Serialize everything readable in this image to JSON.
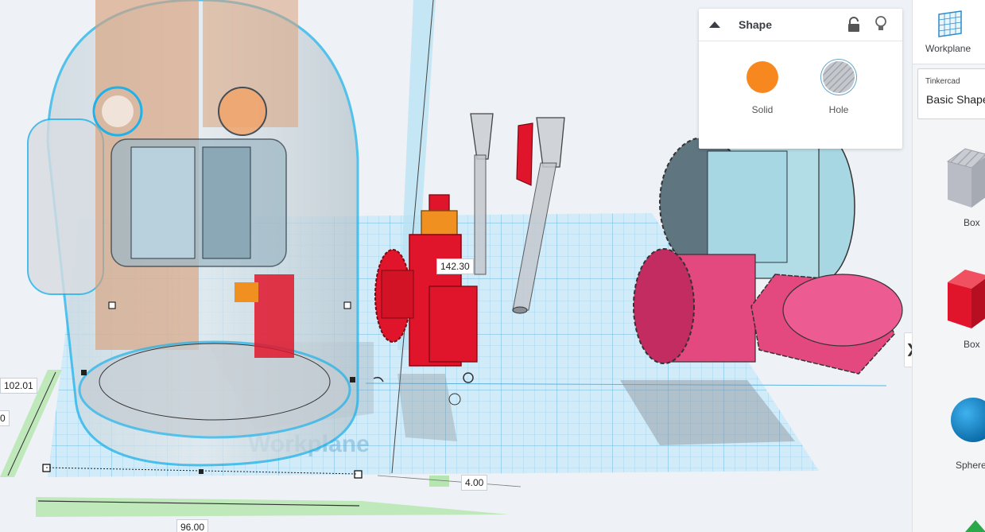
{
  "viewport": {
    "dimensions": {
      "height_value": "102.01",
      "depth_value": "96.00",
      "elevation_value": "4.00",
      "rotation_value": "142.30",
      "cut_value": "0"
    },
    "workplane_watermark": "Workplane"
  },
  "shape_panel": {
    "title": "Shape",
    "solid_label": "Solid",
    "hole_label": "Hole",
    "solid_color": "#f7871f",
    "icons": [
      "collapse-caret-icon",
      "unlock-icon",
      "lightbulb-icon"
    ]
  },
  "sidebar": {
    "workplane_label": "Workplane",
    "library_brand": "Tinkercad",
    "library_name": "Basic Shapes",
    "items": [
      {
        "label": "Box",
        "color": "#b9bcc4"
      },
      {
        "label": "Box",
        "color": "#e0152b"
      },
      {
        "label": "Sphere",
        "color": "#0c8ad1"
      }
    ],
    "expand_icon": "chevron-right-icon"
  },
  "colors": {
    "grid": "#9fd3ef",
    "selection": "#1fb1e8",
    "gear_pink": "#e3487e",
    "part_red": "#e0152b",
    "part_orange": "#f09020",
    "gear_teal": "#a7d7e2"
  }
}
